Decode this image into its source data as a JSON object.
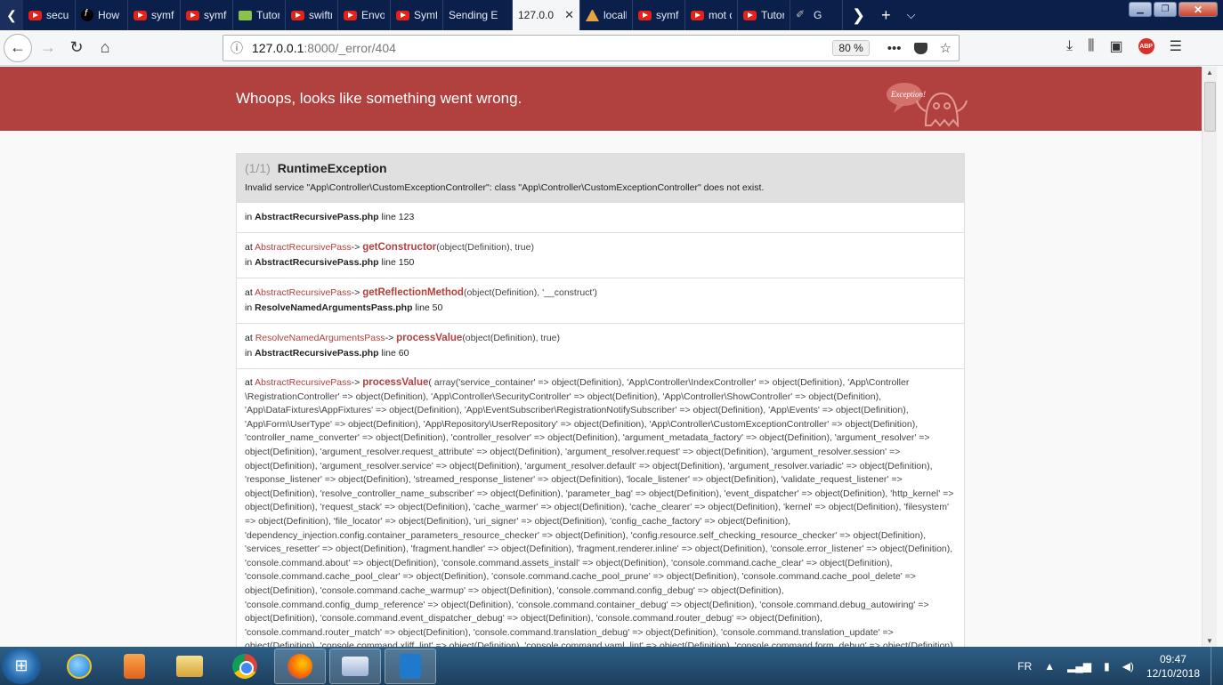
{
  "browser": {
    "tabs": [
      {
        "label": "securi",
        "icon": "youtube-icon"
      },
      {
        "label": "How t",
        "icon": "symfony-icon"
      },
      {
        "label": "symfo",
        "icon": "youtube-icon"
      },
      {
        "label": "symfo",
        "icon": "youtube-icon"
      },
      {
        "label": "Tutori",
        "icon": "w3schools-icon"
      },
      {
        "label": "swiftm",
        "icon": "youtube-icon"
      },
      {
        "label": "Envoy",
        "icon": "youtube-icon"
      },
      {
        "label": "Symfo",
        "icon": "youtube-icon"
      },
      {
        "label": "Sending E",
        "icon": ""
      },
      {
        "label": "127.0.0",
        "icon": "",
        "active": true
      },
      {
        "label": "localh",
        "icon": "xampp-icon"
      },
      {
        "label": "symfo",
        "icon": "youtube-icon"
      },
      {
        "label": "mot d",
        "icon": "youtube-icon"
      },
      {
        "label": "Tutori",
        "icon": "youtube-icon"
      },
      {
        "label": "G",
        "icon": "github-icon"
      }
    ],
    "url": {
      "host": "127.0.0.1",
      "path": ":8000/_error/404"
    },
    "zoom": "80 %"
  },
  "page": {
    "header_title": "Whoops, looks like something went wrong.",
    "ghost_label": "Exception!",
    "exception": {
      "count": "(1/1)",
      "class": "RuntimeException",
      "message": "Invalid service \"App\\Controller\\CustomExceptionController\": class \"App\\Controller\\CustomExceptionController\" does not exist."
    },
    "trace": {
      "first": {
        "in": "in",
        "file": "AbstractRecursivePass.php",
        "line": "line 123"
      },
      "frames": [
        {
          "at": "at",
          "cls": "AbstractRecursivePass",
          "arrow": "->",
          "fn": "getConstructor",
          "args": "(object(Definition), true)",
          "in": "in",
          "file": "AbstractRecursivePass.php",
          "line": "line 150"
        },
        {
          "at": "at",
          "cls": "AbstractRecursivePass",
          "arrow": "->",
          "fn": "getReflectionMethod",
          "args": "(object(Definition), '__construct')",
          "in": "in",
          "file": "ResolveNamedArgumentsPass.php",
          "line": "line 50"
        },
        {
          "at": "at",
          "cls": "ResolveNamedArgumentsPass",
          "arrow": "->",
          "fn": "processValue",
          "args": "(object(Definition), true)",
          "in": "in",
          "file": "AbstractRecursivePass.php",
          "line": "line 60"
        }
      ],
      "long_frame": {
        "at": "at",
        "cls": "AbstractRecursivePass",
        "arrow": "->",
        "fn": "processValue",
        "args": "( array('service_container' => object(Definition), 'App\\Controller\\IndexController' => object(Definition), 'App\\Controller \\RegistrationController' => object(Definition), 'App\\Controller\\SecurityController' => object(Definition), 'App\\Controller\\ShowController' => object(Definition), 'App\\DataFixtures\\AppFixtures' => object(Definition), 'App\\EventSubscriber\\RegistrationNotifySubscriber' => object(Definition), 'App\\Events' => object(Definition), 'App\\Form\\UserType' => object(Definition), 'App\\Repository\\UserRepository' => object(Definition), 'App\\Controller\\CustomExceptionController' => object(Definition), 'controller_name_converter' => object(Definition), 'controller_resolver' => object(Definition), 'argument_metadata_factory' => object(Definition), 'argument_resolver' => object(Definition), 'argument_resolver.request_attribute' => object(Definition), 'argument_resolver.request' => object(Definition), 'argument_resolver.session' => object(Definition), 'argument_resolver.service' => object(Definition), 'argument_resolver.default' => object(Definition), 'argument_resolver.variadic' => object(Definition), 'response_listener' => object(Definition), 'streamed_response_listener' => object(Definition), 'locale_listener' => object(Definition), 'validate_request_listener' => object(Definition), 'resolve_controller_name_subscriber' => object(Definition), 'parameter_bag' => object(Definition), 'event_dispatcher' => object(Definition), 'http_kernel' => object(Definition), 'request_stack' => object(Definition), 'cache_warmer' => object(Definition), 'cache_clearer' => object(Definition), 'kernel' => object(Definition), 'filesystem' => object(Definition), 'file_locator' => object(Definition), 'uri_signer' => object(Definition), 'config_cache_factory' => object(Definition), 'dependency_injection.config.container_parameters_resource_checker' => object(Definition), 'config.resource.self_checking_resource_checker' => object(Definition), 'services_resetter' => object(Definition), 'fragment.handler' => object(Definition), 'fragment.renderer.inline' => object(Definition), 'console.error_listener' => object(Definition), 'console.command.about' => object(Definition), 'console.command.assets_install' => object(Definition), 'console.command.cache_clear' => object(Definition), 'console.command.cache_pool_clear' => object(Definition), 'console.command.cache_pool_prune' => object(Definition), 'console.command.cache_pool_delete' => object(Definition), 'console.command.cache_warmup' => object(Definition), 'console.command.config_debug' => object(Definition), 'console.command.config_dump_reference' => object(Definition), 'console.command.container_debug' => object(Definition), 'console.command.debug_autowiring' => object(Definition), 'console.command.event_dispatcher_debug' => object(Definition), 'console.command.router_debug' => object(Definition), 'console.command.router_match' => object(Definition), 'console.command.translation_debug' => object(Definition), 'console.command.translation_update' => object(Definition), 'console.command.xliff_lint' => object(Definition), 'console.command.yaml_lint' => object(Definition), 'console.command.form_debug' => object(Definition), 'cache.app' => object(Definition),"
      }
    }
  },
  "taskbar": {
    "language": "FR",
    "time": "09:47",
    "date": "12/10/2018"
  },
  "colors": {
    "header_red": "#b0413e",
    "tab_strip": "#0a1f4a"
  }
}
